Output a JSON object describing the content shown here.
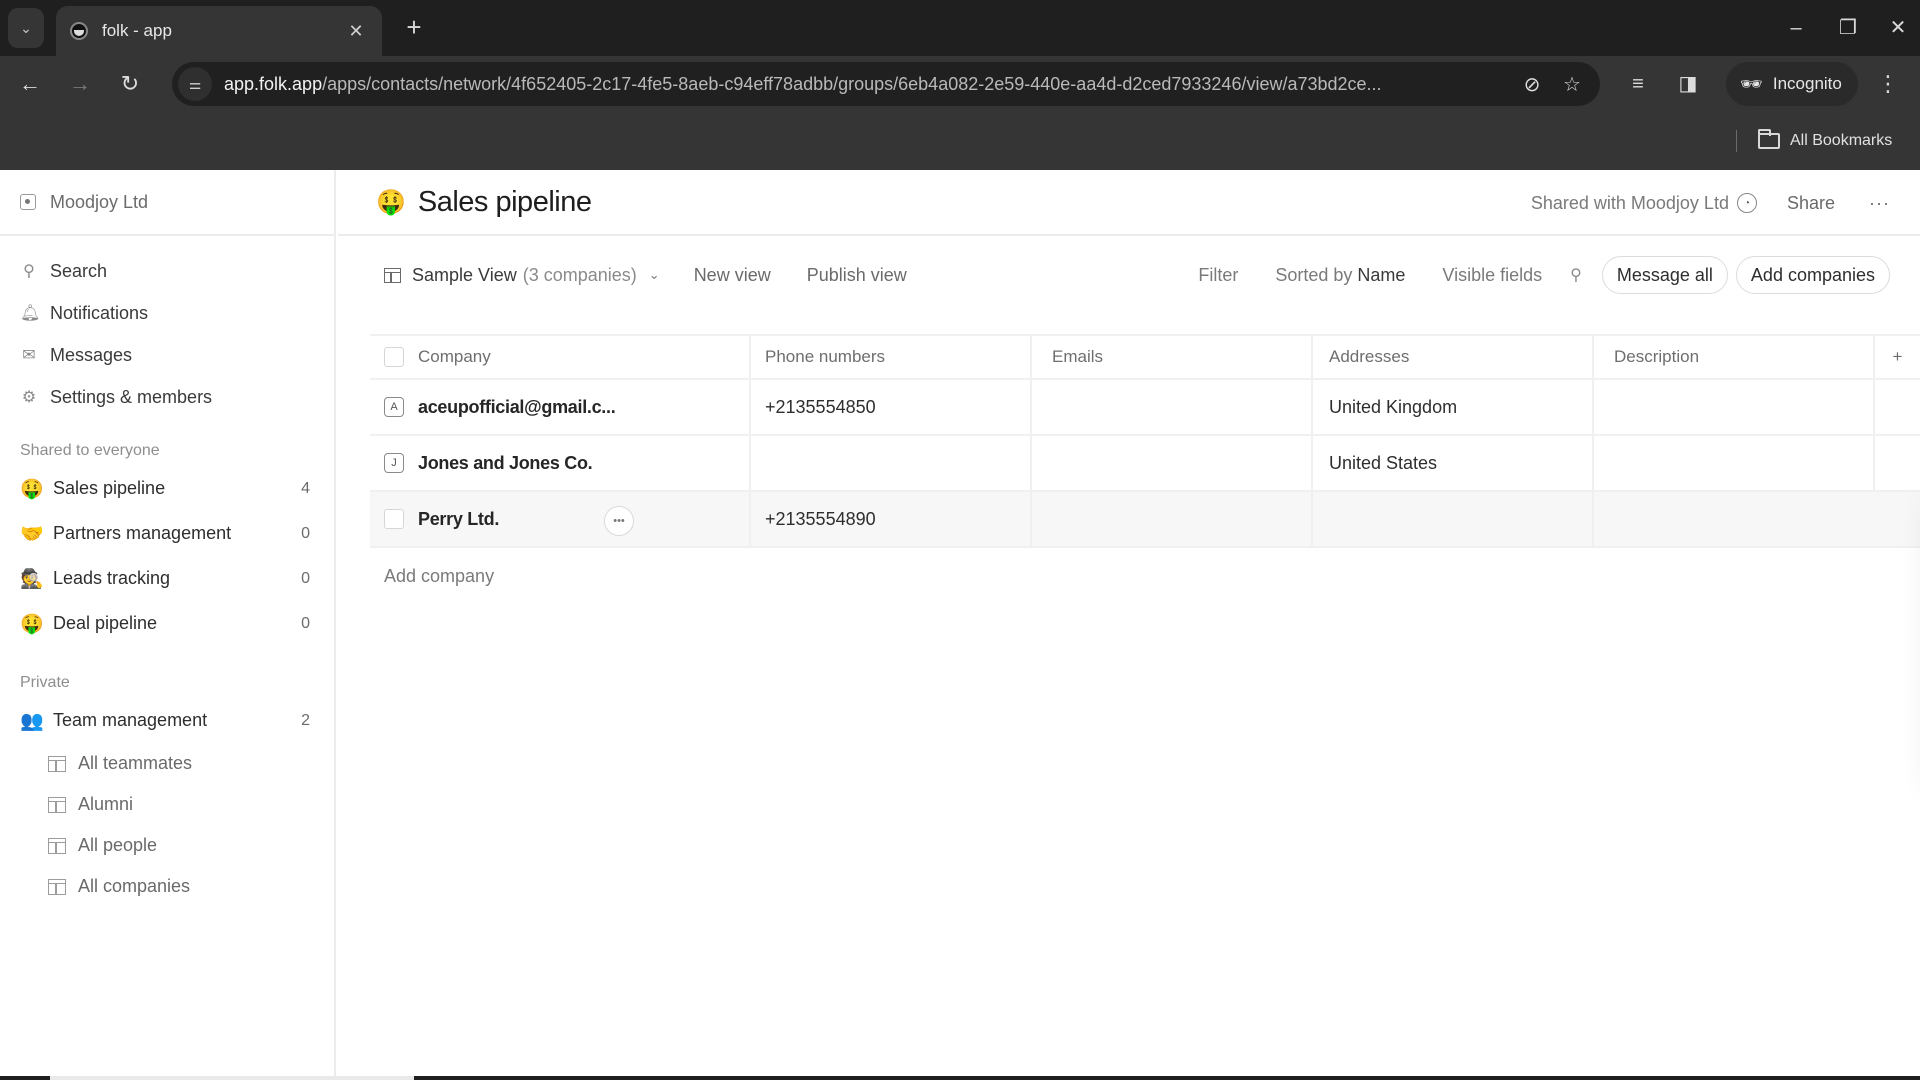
{
  "browser": {
    "tab_title": "folk - app",
    "url_domain": "app.folk.app",
    "url_path": "/apps/contacts/network/4f652405-2c17-4fe5-8aeb-c94eff78adbb/groups/6eb4a082-2e59-440e-aa4d-d2ced7933246/view/a73bd2ce...",
    "incognito_label": "Incognito",
    "bookmarks_label": "All Bookmarks",
    "icons": {
      "tab_list": "chevron-down-icon",
      "new_tab": "plus-icon",
      "back": "arrow-left-icon",
      "forward": "arrow-right-icon",
      "reload": "reload-icon",
      "site_info": "tune-icon",
      "eye_off": "eye-off-icon",
      "bookmark": "star-icon",
      "media": "media-queue-icon",
      "side_panel": "side-panel-icon",
      "menu": "kebab-icon"
    }
  },
  "sidebar": {
    "workspace": "Moodjoy Ltd",
    "nav": [
      {
        "label": "Search",
        "icon": "search-icon"
      },
      {
        "label": "Notifications",
        "icon": "bell-icon"
      },
      {
        "label": "Messages",
        "icon": "mail-icon"
      },
      {
        "label": "Settings & members",
        "icon": "gear-icon"
      }
    ],
    "shared_label": "Shared to everyone",
    "shared_groups": [
      {
        "label": "Sales pipeline",
        "emoji": "🤑",
        "count": "4"
      },
      {
        "label": "Partners management",
        "emoji": "🤝",
        "count": "0"
      },
      {
        "label": "Leads tracking",
        "emoji": "🕵️",
        "count": "0"
      },
      {
        "label": "Deal pipeline",
        "emoji": "🤑",
        "count": "0"
      }
    ],
    "private_label": "Private",
    "private_groups": [
      {
        "label": "Team management",
        "emoji": "👥",
        "count": "2"
      }
    ],
    "private_views": [
      {
        "label": "All teammates"
      },
      {
        "label": "Alumni"
      },
      {
        "label": "All people"
      },
      {
        "label": "All companies"
      }
    ]
  },
  "header": {
    "emoji": "🤑",
    "title": "Sales pipeline",
    "shared_with": "Shared with Moodjoy Ltd",
    "share_label": "Share",
    "more_label": "···"
  },
  "viewbar": {
    "view_name": "Sample View",
    "view_count": "(3 companies)",
    "new_view": "New view",
    "publish_view": "Publish view",
    "filter": "Filter",
    "sorted_prefix": "Sorted by",
    "sorted_field": "Name",
    "visible_fields": "Visible fields",
    "message_all": "Message all",
    "add_companies": "Add companies"
  },
  "table": {
    "columns": [
      "Company",
      "Phone numbers",
      "Emails",
      "Addresses",
      "Description"
    ],
    "rows": [
      {
        "badge": "A",
        "company": "aceupofficial@gmail.c...",
        "phone": "+2135554850",
        "email": "",
        "address": "United Kingdom",
        "description": ""
      },
      {
        "badge": "J",
        "company": "Jones and Jones Co.",
        "phone": "",
        "email": "",
        "address": "United States",
        "description": ""
      },
      {
        "badge": "",
        "company": "Perry Ltd.",
        "phone": "+2135554890",
        "email": "",
        "address": "",
        "description": ""
      }
    ],
    "add_company": "Add company",
    "add_column": "+"
  },
  "editor": {
    "value": ""
  },
  "help_label": "?"
}
